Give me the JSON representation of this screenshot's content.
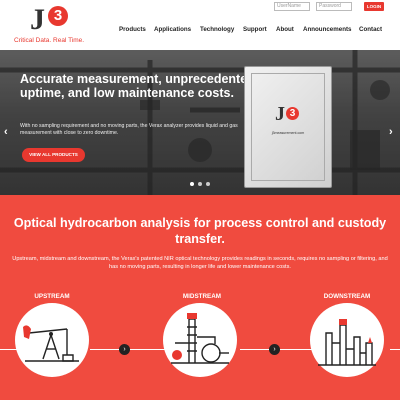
{
  "header": {
    "logo": {
      "letter": "J",
      "number": "3",
      "tagline": "Critical Data. Real Time."
    },
    "login": {
      "username_placeholder": "UserName",
      "password_placeholder": "Password",
      "button": "LOGIN"
    },
    "nav": [
      {
        "label": "Products"
      },
      {
        "label": "Applications"
      },
      {
        "label": "Technology"
      },
      {
        "label": "Support"
      },
      {
        "label": "About"
      },
      {
        "label": "Announcements"
      },
      {
        "label": "Contact"
      }
    ]
  },
  "hero": {
    "title": "Accurate measurement, unprecedented uptime, and low maintenance costs.",
    "body": "With no sampling requirement and no moving parts, the Verax analyzer provides liquid and gas measurement with close to zero downtime.",
    "button": "VIEW ALL PRODUCTS",
    "device_url": "j3measurement.com",
    "device_logo": {
      "letter": "J",
      "number": "3"
    },
    "slides": {
      "count": 3,
      "active": 0
    }
  },
  "section": {
    "title": "Optical hydrocarbon analysis for process control and custody transfer.",
    "body": "Upstream, midstream and downstream, the Verax's patented NIR optical technology provides readings in seconds, requires no sampling or filtering, and has no moving parts, resulting in longer life and lower maintenance costs.",
    "stages": [
      {
        "label": "UPSTREAM",
        "icon": "oil-pump-icon"
      },
      {
        "label": "MIDSTREAM",
        "icon": "refinery-icon"
      },
      {
        "label": "DOWNSTREAM",
        "icon": "storage-tanks-icon"
      }
    ]
  },
  "colors": {
    "brand_red": "#e8382f",
    "section_red": "#f04b3f",
    "dark": "#222222"
  }
}
